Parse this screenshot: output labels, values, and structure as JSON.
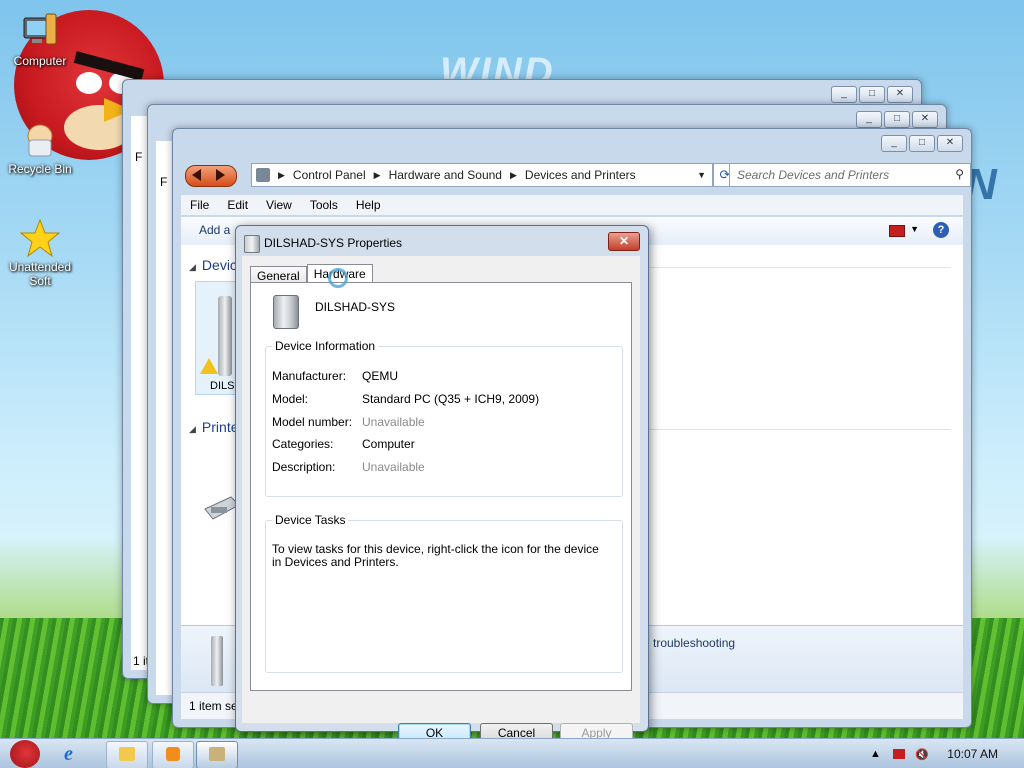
{
  "desktop": {
    "icons": [
      {
        "label": "Computer"
      },
      {
        "label": "Recycle Bin"
      },
      {
        "label": "Unattended Soft"
      }
    ]
  },
  "explorer": {
    "address": {
      "crumbs": [
        "Control Panel",
        "Hardware and Sound",
        "Devices and Printers"
      ]
    },
    "search_placeholder": "Search Devices and Printers",
    "menu": [
      "File",
      "Edit",
      "View",
      "Tools",
      "Help"
    ],
    "command_label": "Add a",
    "group_devices": "Devic",
    "group_printers": "Printe",
    "device_label": "DILS",
    "status_hint": "troubleshooting",
    "status_count": "1 item sele",
    "back_windows_count": "1 it",
    "back_menu_letter": "F"
  },
  "dialog": {
    "title": "DILSHAD-SYS Properties",
    "close_label": "✕",
    "tabs": [
      "General",
      "Hardware"
    ],
    "device_name": "DILSHAD-SYS",
    "device_info": {
      "legend": "Device Information",
      "rows": [
        {
          "label": "Manufacturer:",
          "value": "QEMU"
        },
        {
          "label": "Model:",
          "value": "Standard PC (Q35 + ICH9, 2009)"
        },
        {
          "label": "Model number:",
          "value": "Unavailable"
        },
        {
          "label": "Categories:",
          "value": "Computer"
        },
        {
          "label": "Description:",
          "value": "Unavailable"
        }
      ]
    },
    "device_tasks": {
      "legend": "Device Tasks",
      "text": "To view tasks for this device, right-click the icon for the device in Devices and Printers."
    },
    "buttons": {
      "ok": "OK",
      "cancel": "Cancel",
      "apply": "Apply"
    }
  },
  "taskbar": {
    "clock": "10:07 AM"
  },
  "colors": {
    "accent_blue": "#1e3f8a",
    "nav_orange": "#d84e18",
    "grayed_value": "#8a8a8a"
  }
}
